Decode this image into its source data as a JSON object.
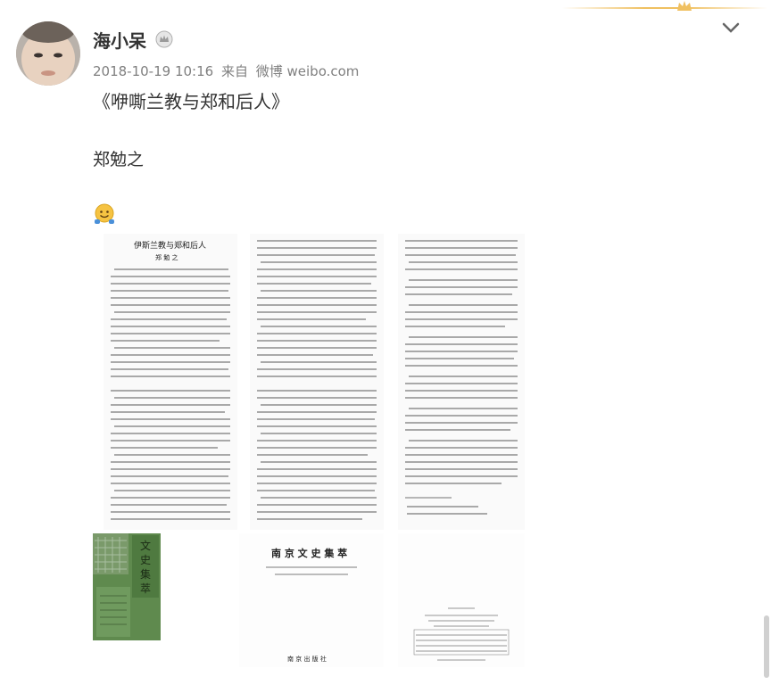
{
  "post": {
    "user": {
      "name": "海小呆"
    },
    "meta": {
      "timestamp": "2018-10-19 10:16",
      "from_label": "来自",
      "source": "微博 weibo.com"
    },
    "title": "《咿嘶兰教与郑和后人》",
    "author": "郑勉之",
    "emoji": "smile-emoji-icon"
  },
  "scan": {
    "page1_title": "伊斯兰教与郑和后人",
    "page1_author": "郑 勉 之",
    "book_title": "南 京 文 史 集 萃",
    "book_publisher": "南 京 出 版 社",
    "cover_title": "文史集萃"
  },
  "colors": {
    "gold": "#f0c060",
    "cover_green": "#5f8a4e"
  }
}
